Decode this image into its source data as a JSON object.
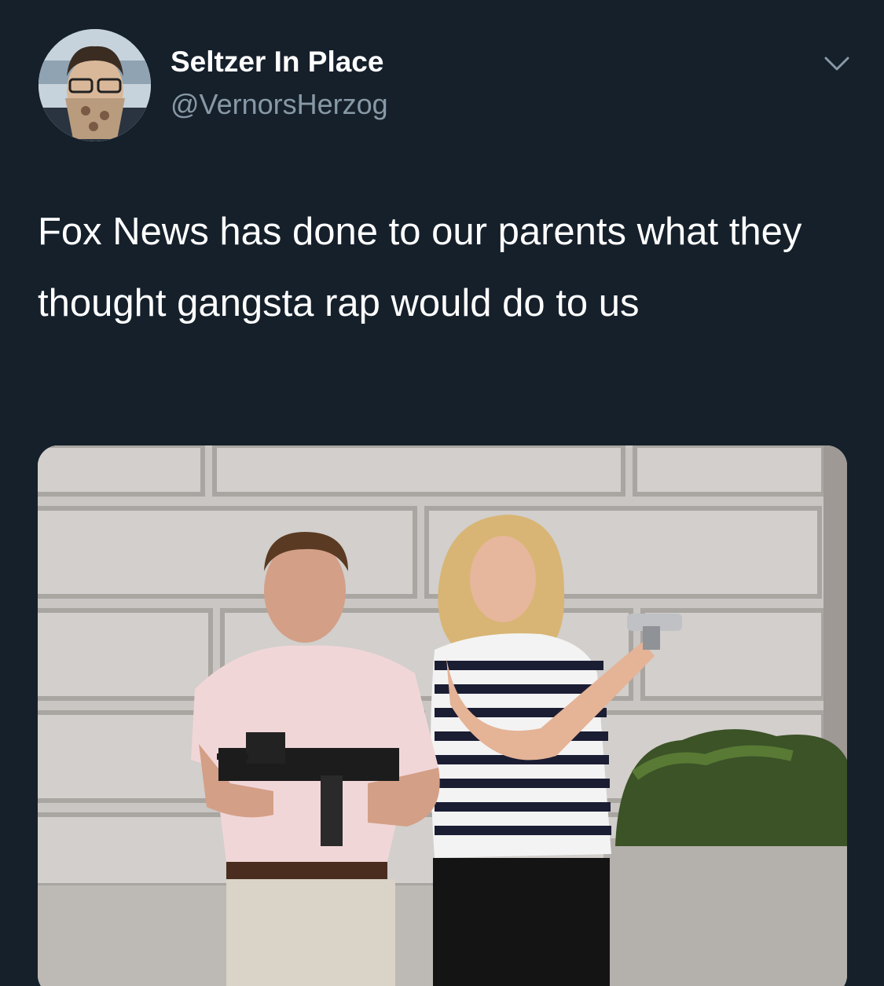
{
  "tweet": {
    "display_name": "Seltzer In Place",
    "handle": "@VernorsHerzog",
    "text": "Fox News has done to our parents what they thought gangsta rap would do to us",
    "avatar_icon": "profile-avatar",
    "menu_icon": "chevron-down-icon",
    "media_description_icon": "photo"
  },
  "colors": {
    "background": "#15202b",
    "primary_text": "#ffffff",
    "secondary_text": "#8899a6"
  }
}
